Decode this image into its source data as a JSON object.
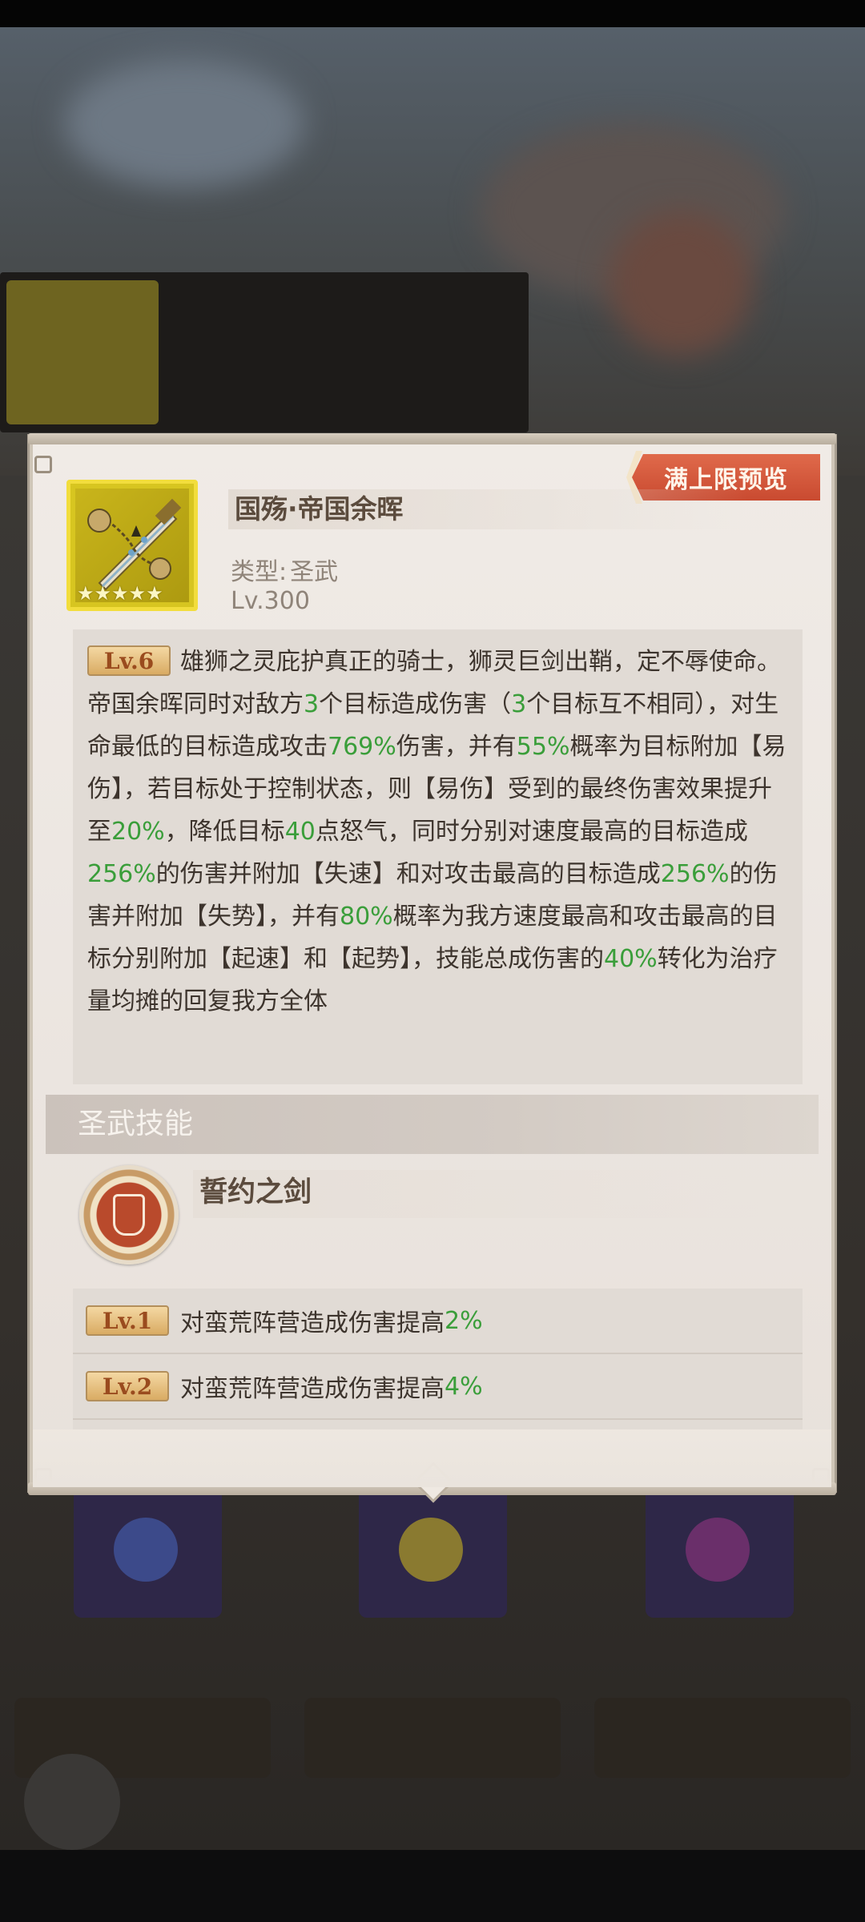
{
  "dialog": {
    "preview_button": "满上限预览",
    "item": {
      "name": "国殇·帝国余晖",
      "type_label": "类型:",
      "type_value": "圣武",
      "level": "Lv.300",
      "stars": 5,
      "icon": "sword-chain-icon"
    },
    "description": {
      "badge": "Lv.6",
      "segments": [
        {
          "t": "雄狮之灵庇护真正的骑士，狮灵巨剑出鞘，定不辱使命。帝国余晖同时对敌方",
          "g": false
        },
        {
          "t": "3",
          "g": true
        },
        {
          "t": "个目标造成伤害（",
          "g": false
        },
        {
          "t": "3",
          "g": true
        },
        {
          "t": "个目标互不相同），对生命最低的目标造成攻击",
          "g": false
        },
        {
          "t": "769%",
          "g": true
        },
        {
          "t": "伤害，并有",
          "g": false
        },
        {
          "t": "55%",
          "g": true
        },
        {
          "t": "概率为目标附加【易伤】，若目标处于控制状态，则【易伤】受到的最终伤害效果提升至",
          "g": false
        },
        {
          "t": "20%",
          "g": true
        },
        {
          "t": "，降低目标",
          "g": false
        },
        {
          "t": "40",
          "g": true
        },
        {
          "t": "点怒气，同时分别对速度最高的目标造成",
          "g": false
        },
        {
          "t": "256%",
          "g": true
        },
        {
          "t": "的伤害并附加【失速】和对攻击最高的目标造成",
          "g": false
        },
        {
          "t": "256%",
          "g": true
        },
        {
          "t": "的伤害并附加【失势】，并有",
          "g": false
        },
        {
          "t": "80%",
          "g": true
        },
        {
          "t": "概率为我方速度最高和攻击最高的目标分别附加【起速】和【起势】，技能总成伤害的",
          "g": false
        },
        {
          "t": "40%",
          "g": true
        },
        {
          "t": "转化为治疗量均摊的回复我方全体",
          "g": false
        }
      ]
    },
    "section_title": "圣武技能",
    "skill": {
      "name": "誓约之剑",
      "icon": "wolf-shield-icon",
      "levels": [
        {
          "badge": "Lv.1",
          "text": "对蛮荒阵营造成伤害提高",
          "value": "2%"
        },
        {
          "badge": "Lv.2",
          "text": "对蛮荒阵营造成伤害提高",
          "value": "4%"
        }
      ]
    }
  },
  "colors": {
    "accent_green": "#3a9e3a",
    "preview_button": "#d6573a",
    "panel_bg": "#ece6e1",
    "item_frame_gold": "#f2dd3c"
  }
}
